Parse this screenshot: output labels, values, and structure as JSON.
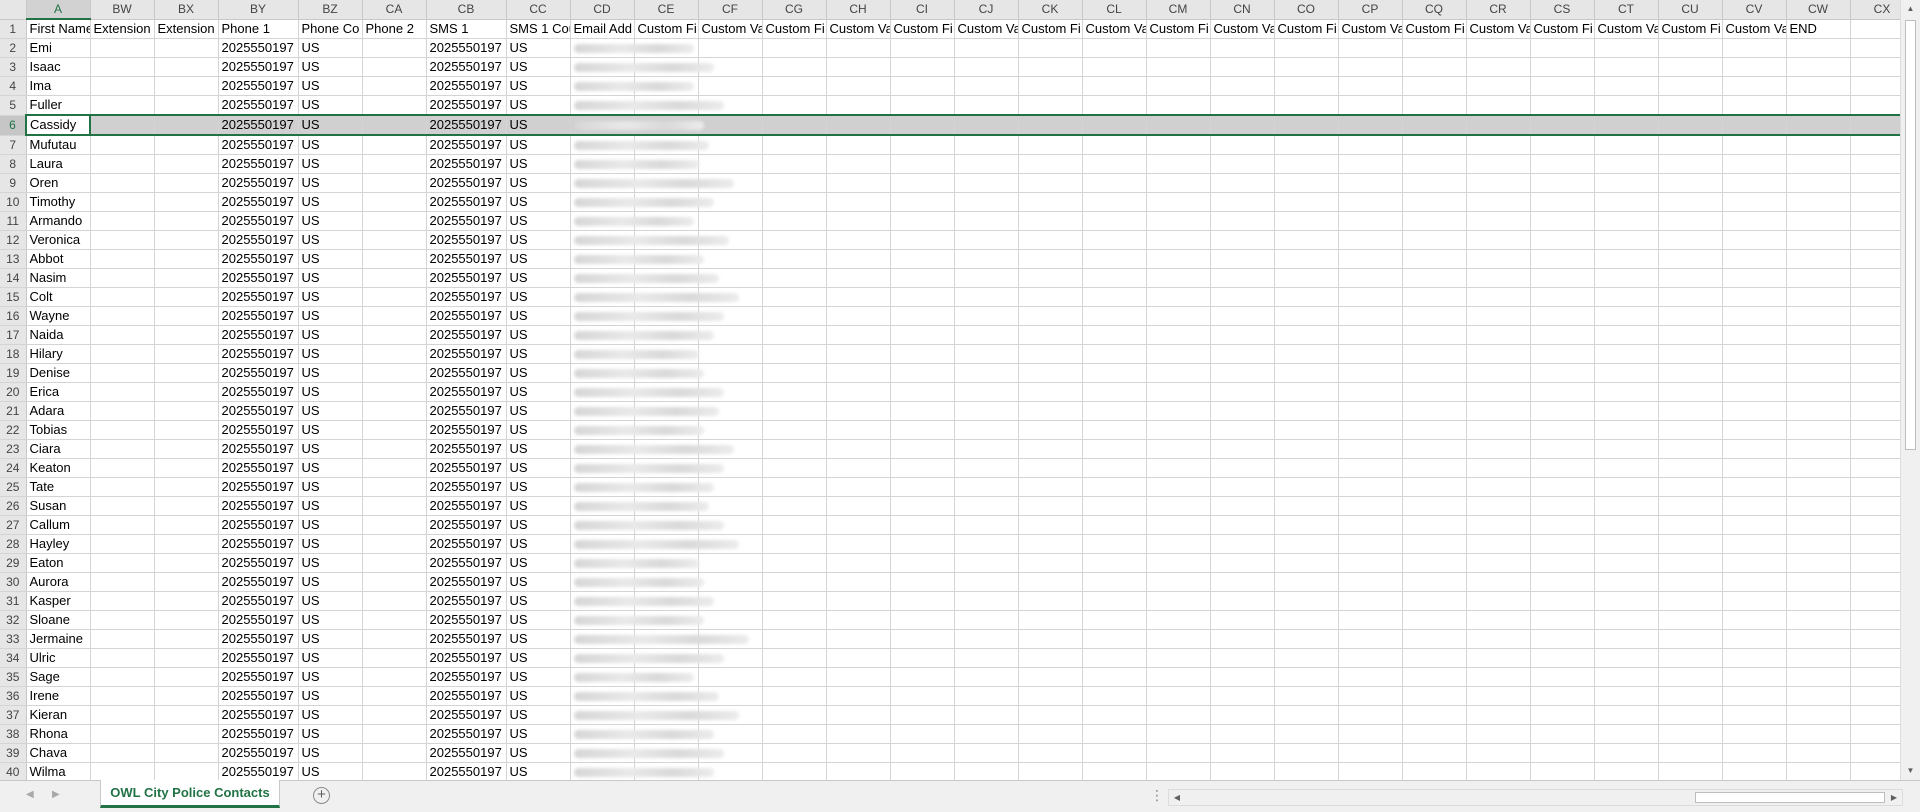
{
  "sheet": {
    "columns": [
      "A",
      "BW",
      "BX",
      "BY",
      "BZ",
      "CA",
      "CB",
      "CC",
      "CD",
      "CE",
      "CF",
      "CG",
      "CH",
      "CI",
      "CJ",
      "CK",
      "CL",
      "CM",
      "CN",
      "CO",
      "CP",
      "CQ",
      "CR",
      "CS",
      "CT",
      "CU",
      "CV",
      "CW",
      "CX"
    ],
    "headers": [
      "First Name",
      "Extension",
      "Extension",
      "Phone 1",
      "Phone Co",
      "Phone 2",
      "SMS 1",
      "SMS 1 Cou",
      "Email Add",
      "Custom Fi",
      "Custom Va",
      "Custom Fi",
      "Custom Va",
      "Custom Fi",
      "Custom Va",
      "Custom Fi",
      "Custom Va",
      "Custom Fi",
      "Custom Va",
      "Custom Fi",
      "Custom Va",
      "Custom Fi",
      "Custom Va",
      "Custom Fi",
      "Custom Va",
      "Custom Fi",
      "Custom Va",
      "END",
      ""
    ],
    "phone_value": "2025550197",
    "country_value": "US",
    "selected_row": 6,
    "rows": [
      {
        "num": "2",
        "first": "Emi"
      },
      {
        "num": "3",
        "first": "Isaac"
      },
      {
        "num": "4",
        "first": "Ima"
      },
      {
        "num": "5",
        "first": "Fuller"
      },
      {
        "num": "6",
        "first": "Cassidy"
      },
      {
        "num": "7",
        "first": "Mufutau"
      },
      {
        "num": "8",
        "first": "Laura"
      },
      {
        "num": "9",
        "first": "Oren"
      },
      {
        "num": "10",
        "first": "Timothy"
      },
      {
        "num": "11",
        "first": "Armando"
      },
      {
        "num": "12",
        "first": "Veronica"
      },
      {
        "num": "13",
        "first": "Abbot"
      },
      {
        "num": "14",
        "first": "Nasim"
      },
      {
        "num": "15",
        "first": "Colt"
      },
      {
        "num": "16",
        "first": "Wayne"
      },
      {
        "num": "17",
        "first": "Naida"
      },
      {
        "num": "18",
        "first": "Hilary"
      },
      {
        "num": "19",
        "first": "Denise"
      },
      {
        "num": "20",
        "first": "Erica"
      },
      {
        "num": "21",
        "first": "Adara"
      },
      {
        "num": "22",
        "first": "Tobias"
      },
      {
        "num": "23",
        "first": "Ciara"
      },
      {
        "num": "24",
        "first": "Keaton"
      },
      {
        "num": "25",
        "first": "Tate"
      },
      {
        "num": "26",
        "first": "Susan"
      },
      {
        "num": "27",
        "first": "Callum"
      },
      {
        "num": "28",
        "first": "Hayley"
      },
      {
        "num": "29",
        "first": "Eaton"
      },
      {
        "num": "30",
        "first": "Aurora"
      },
      {
        "num": "31",
        "first": "Kasper"
      },
      {
        "num": "32",
        "first": "Sloane"
      },
      {
        "num": "33",
        "first": "Jermaine"
      },
      {
        "num": "34",
        "first": "Ulric"
      },
      {
        "num": "35",
        "first": "Sage"
      },
      {
        "num": "36",
        "first": "Irene"
      },
      {
        "num": "37",
        "first": "Kieran"
      },
      {
        "num": "38",
        "first": "Rhona"
      },
      {
        "num": "39",
        "first": "Chava"
      },
      {
        "num": "40",
        "first": "Wilma"
      }
    ]
  },
  "tabs": {
    "active_sheet": "OWL City Police Contacts"
  },
  "icons": {
    "tab_prev": "triangle-left-icon",
    "tab_next": "triangle-right-icon",
    "add_sheet": "plus-circle-icon",
    "scroll_up": "triangle-up-icon",
    "scroll_down": "triangle-down-icon",
    "scroll_left": "triangle-left-icon",
    "scroll_right": "triangle-right-icon"
  },
  "colors": {
    "accent": "#217346",
    "header_bg": "#e6e6e6",
    "selected_row_bg": "#d0d0d0",
    "gridline": "#d4d4d4"
  }
}
